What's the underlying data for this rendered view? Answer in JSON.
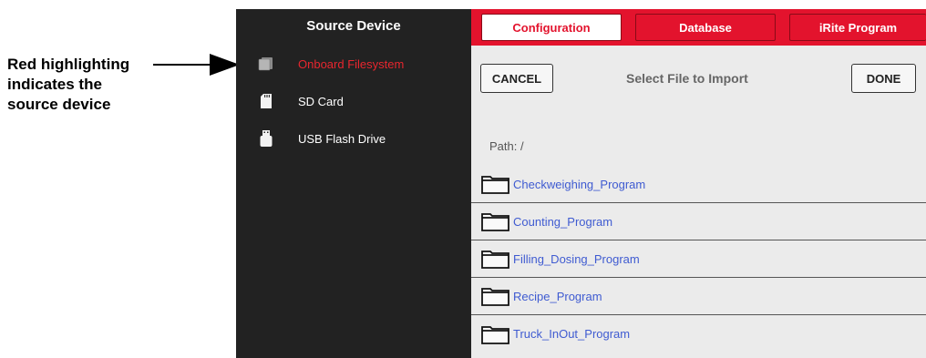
{
  "callout": {
    "lines": [
      "Red highlighting",
      "indicates the",
      "source device"
    ]
  },
  "sidebar": {
    "title": "Source Device",
    "items": [
      {
        "label": "Onboard Filesystem",
        "icon": "filesystem-icon",
        "active": true
      },
      {
        "label": "SD Card",
        "icon": "sd-card-icon",
        "active": false
      },
      {
        "label": "USB Flash Drive",
        "icon": "usb-drive-icon",
        "active": false
      }
    ]
  },
  "tabs": [
    {
      "label": "Configuration",
      "selected": true
    },
    {
      "label": "Database",
      "selected": false
    },
    {
      "label": "iRite Program",
      "selected": false
    }
  ],
  "dialog": {
    "cancel_label": "CANCEL",
    "title": "Select File to Import",
    "done_label": "DONE"
  },
  "path": "Path: /",
  "files": [
    {
      "name": "Checkweighing_Program",
      "icon": "folder-icon"
    },
    {
      "name": "Counting_Program",
      "icon": "folder-icon"
    },
    {
      "name": "Filling_Dosing_Program",
      "icon": "folder-icon"
    },
    {
      "name": "Recipe_Program",
      "icon": "folder-icon"
    },
    {
      "name": "Truck_InOut_Program",
      "icon": "folder-icon"
    }
  ],
  "colors": {
    "accent_red": "#e3132d",
    "active_item_red": "#e8262e",
    "sidebar_bg": "#222222",
    "panel_bg": "#ebebeb",
    "link_blue": "#3f5bd1"
  }
}
